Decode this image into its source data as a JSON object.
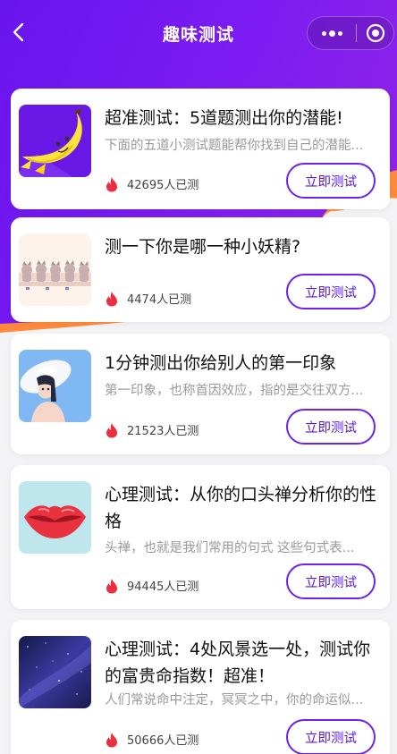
{
  "header": {
    "title": "趣味测试",
    "back_icon": "chevron-left-icon",
    "more_icon": "more-dots-icon",
    "close_icon": "target-close-icon"
  },
  "colors": {
    "header_purple": "#7a1cf0",
    "accent_orange": "#ff8a3d",
    "button_purple": "#6c22ea",
    "fire_red": "#ec2f3e"
  },
  "tests": [
    {
      "title": "超准测试：5道题测出你的潜能!",
      "desc": "下面的五道小测试题能帮你找到自己的潜能...",
      "count": "42695人已测",
      "button": "立即测试",
      "thumb": "banana-image"
    },
    {
      "title": "测一下你是哪一种小妖精?",
      "desc": "",
      "count": "4474人已测",
      "button": "立即测试",
      "thumb": "cats-image"
    },
    {
      "title": "1分钟测出你给别人的第一印象",
      "desc": "第一印象，也称首因效应，指的是交往双方...",
      "count": "21523人已测",
      "button": "立即测试",
      "thumb": "girl-hat-image"
    },
    {
      "title": "心理测试：从你的口头禅分析你的性格",
      "desc": "头禅，也就是我们常用的句式 这些句式表...",
      "count": "94445人已测",
      "button": "立即测试",
      "thumb": "lips-image"
    },
    {
      "title": "心理测试：4处风景选一处，测试你的富贵命指数！超准！",
      "desc": "人们常说命中注定，冥冥之中，你的命运似...",
      "count": "50666人已测",
      "button": "立即测试",
      "thumb": "galaxy-image"
    }
  ]
}
